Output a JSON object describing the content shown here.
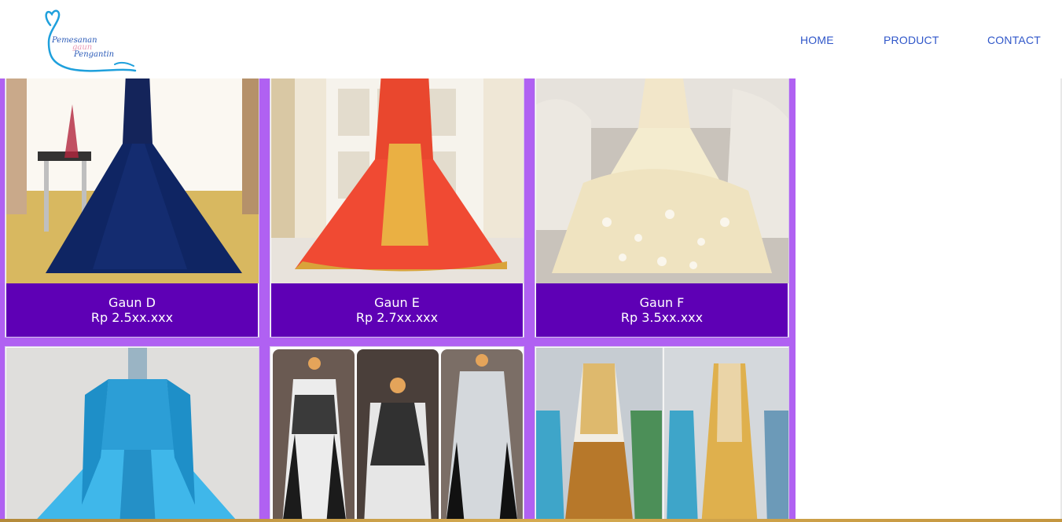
{
  "logo": {
    "line1": "Pemesanan",
    "line2": "gaun",
    "line3": "Pengantin"
  },
  "nav": {
    "home": "HOME",
    "product": "PRODUCT",
    "contact": "CONTACT"
  },
  "products_row1": [
    {
      "name": "Gaun D",
      "price": "Rp 2.5xx.xxx"
    },
    {
      "name": "Gaun E",
      "price": "Rp 2.7xx.xxx"
    },
    {
      "name": "Gaun F",
      "price": "Rp 3.5xx.xxx"
    }
  ],
  "colors": {
    "grid_background": "#b061f2",
    "caption_background": "#5e00b5",
    "nav_link": "#2f56c9"
  }
}
